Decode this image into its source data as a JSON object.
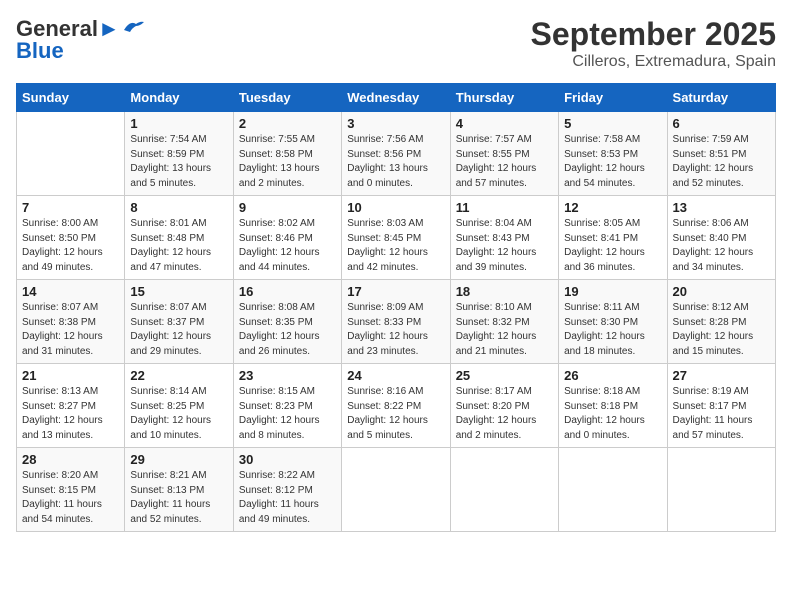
{
  "logo": {
    "line1": "General",
    "line2": "Blue"
  },
  "title": "September 2025",
  "subtitle": "Cilleros, Extremadura, Spain",
  "weekdays": [
    "Sunday",
    "Monday",
    "Tuesday",
    "Wednesday",
    "Thursday",
    "Friday",
    "Saturday"
  ],
  "weeks": [
    [
      {
        "day": "",
        "info": ""
      },
      {
        "day": "1",
        "info": "Sunrise: 7:54 AM\nSunset: 8:59 PM\nDaylight: 13 hours\nand 5 minutes."
      },
      {
        "day": "2",
        "info": "Sunrise: 7:55 AM\nSunset: 8:58 PM\nDaylight: 13 hours\nand 2 minutes."
      },
      {
        "day": "3",
        "info": "Sunrise: 7:56 AM\nSunset: 8:56 PM\nDaylight: 13 hours\nand 0 minutes."
      },
      {
        "day": "4",
        "info": "Sunrise: 7:57 AM\nSunset: 8:55 PM\nDaylight: 12 hours\nand 57 minutes."
      },
      {
        "day": "5",
        "info": "Sunrise: 7:58 AM\nSunset: 8:53 PM\nDaylight: 12 hours\nand 54 minutes."
      },
      {
        "day": "6",
        "info": "Sunrise: 7:59 AM\nSunset: 8:51 PM\nDaylight: 12 hours\nand 52 minutes."
      }
    ],
    [
      {
        "day": "7",
        "info": "Sunrise: 8:00 AM\nSunset: 8:50 PM\nDaylight: 12 hours\nand 49 minutes."
      },
      {
        "day": "8",
        "info": "Sunrise: 8:01 AM\nSunset: 8:48 PM\nDaylight: 12 hours\nand 47 minutes."
      },
      {
        "day": "9",
        "info": "Sunrise: 8:02 AM\nSunset: 8:46 PM\nDaylight: 12 hours\nand 44 minutes."
      },
      {
        "day": "10",
        "info": "Sunrise: 8:03 AM\nSunset: 8:45 PM\nDaylight: 12 hours\nand 42 minutes."
      },
      {
        "day": "11",
        "info": "Sunrise: 8:04 AM\nSunset: 8:43 PM\nDaylight: 12 hours\nand 39 minutes."
      },
      {
        "day": "12",
        "info": "Sunrise: 8:05 AM\nSunset: 8:41 PM\nDaylight: 12 hours\nand 36 minutes."
      },
      {
        "day": "13",
        "info": "Sunrise: 8:06 AM\nSunset: 8:40 PM\nDaylight: 12 hours\nand 34 minutes."
      }
    ],
    [
      {
        "day": "14",
        "info": "Sunrise: 8:07 AM\nSunset: 8:38 PM\nDaylight: 12 hours\nand 31 minutes."
      },
      {
        "day": "15",
        "info": "Sunrise: 8:07 AM\nSunset: 8:37 PM\nDaylight: 12 hours\nand 29 minutes."
      },
      {
        "day": "16",
        "info": "Sunrise: 8:08 AM\nSunset: 8:35 PM\nDaylight: 12 hours\nand 26 minutes."
      },
      {
        "day": "17",
        "info": "Sunrise: 8:09 AM\nSunset: 8:33 PM\nDaylight: 12 hours\nand 23 minutes."
      },
      {
        "day": "18",
        "info": "Sunrise: 8:10 AM\nSunset: 8:32 PM\nDaylight: 12 hours\nand 21 minutes."
      },
      {
        "day": "19",
        "info": "Sunrise: 8:11 AM\nSunset: 8:30 PM\nDaylight: 12 hours\nand 18 minutes."
      },
      {
        "day": "20",
        "info": "Sunrise: 8:12 AM\nSunset: 8:28 PM\nDaylight: 12 hours\nand 15 minutes."
      }
    ],
    [
      {
        "day": "21",
        "info": "Sunrise: 8:13 AM\nSunset: 8:27 PM\nDaylight: 12 hours\nand 13 minutes."
      },
      {
        "day": "22",
        "info": "Sunrise: 8:14 AM\nSunset: 8:25 PM\nDaylight: 12 hours\nand 10 minutes."
      },
      {
        "day": "23",
        "info": "Sunrise: 8:15 AM\nSunset: 8:23 PM\nDaylight: 12 hours\nand 8 minutes."
      },
      {
        "day": "24",
        "info": "Sunrise: 8:16 AM\nSunset: 8:22 PM\nDaylight: 12 hours\nand 5 minutes."
      },
      {
        "day": "25",
        "info": "Sunrise: 8:17 AM\nSunset: 8:20 PM\nDaylight: 12 hours\nand 2 minutes."
      },
      {
        "day": "26",
        "info": "Sunrise: 8:18 AM\nSunset: 8:18 PM\nDaylight: 12 hours\nand 0 minutes."
      },
      {
        "day": "27",
        "info": "Sunrise: 8:19 AM\nSunset: 8:17 PM\nDaylight: 11 hours\nand 57 minutes."
      }
    ],
    [
      {
        "day": "28",
        "info": "Sunrise: 8:20 AM\nSunset: 8:15 PM\nDaylight: 11 hours\nand 54 minutes."
      },
      {
        "day": "29",
        "info": "Sunrise: 8:21 AM\nSunset: 8:13 PM\nDaylight: 11 hours\nand 52 minutes."
      },
      {
        "day": "30",
        "info": "Sunrise: 8:22 AM\nSunset: 8:12 PM\nDaylight: 11 hours\nand 49 minutes."
      },
      {
        "day": "",
        "info": ""
      },
      {
        "day": "",
        "info": ""
      },
      {
        "day": "",
        "info": ""
      },
      {
        "day": "",
        "info": ""
      }
    ]
  ]
}
